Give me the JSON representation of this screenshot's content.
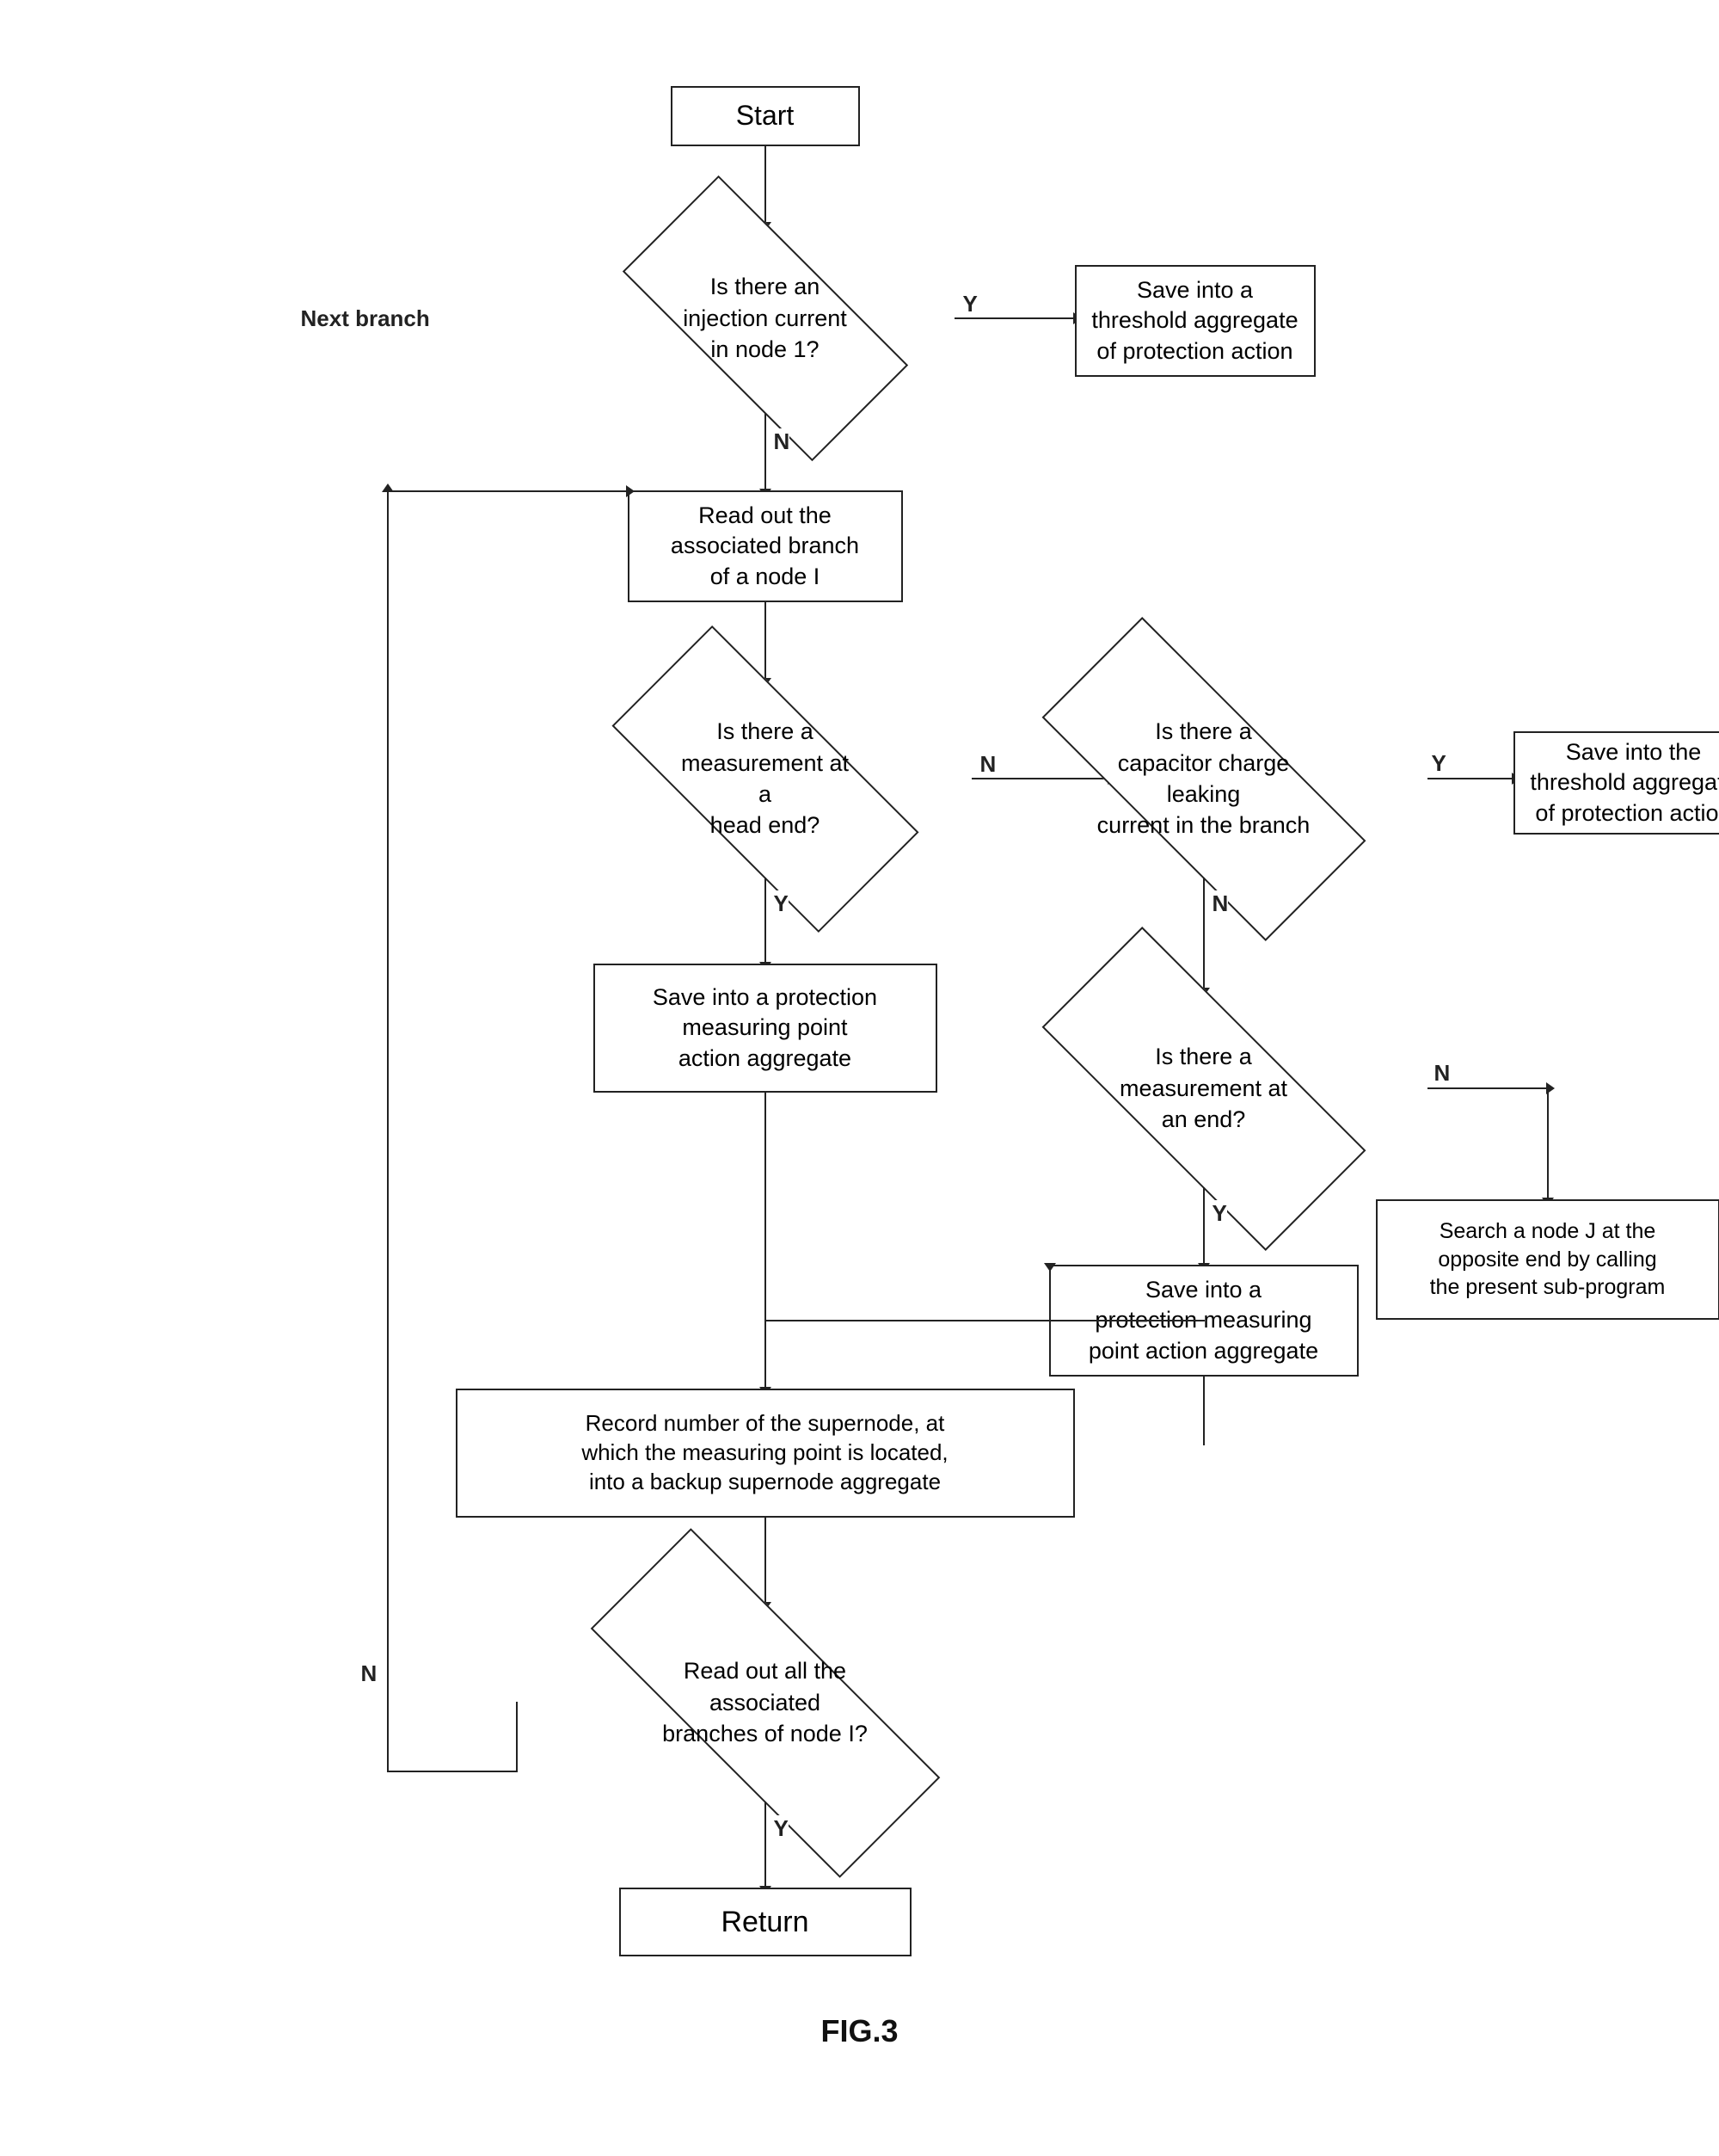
{
  "diagram": {
    "title": "FIG.3",
    "nodes": {
      "start": "Start",
      "injection_q": "Is there an\ninjection current\nin node 1?",
      "save_threshold_1": "Save into a\nthreshold aggregate\nof protection action",
      "read_branch": "Read out the\nassociated branch\nof a node I",
      "measurement_head_q": "Is there a\nmeasurement at a\nhead end?",
      "capacitor_q": "Is there a\ncapacitor charge leaking\ncurrent in the branch",
      "save_threshold_2": "Save into the\nthreshold aggregate\nof protection action",
      "save_protect_1": "Save into a protection\nmeasuring point\naction aggregate",
      "measurement_end_q": "Is there a\nmeasurement at\nan end?",
      "save_protect_2": "Save into a\nprotection measuring\npoint action aggregate",
      "search_node": "Search a node J at the\nopposite end by calling\nthe present sub-program",
      "record_supernode": "Record number of the supernode, at\nwhich the measuring point is located,\ninto a backup supernode aggregate",
      "read_branches_q": "Read out all the associated\nbranches of node I?",
      "return": "Return"
    },
    "labels": {
      "next_branch": "Next branch",
      "y1": "Y",
      "n1": "N",
      "y2": "Y",
      "n2": "N",
      "y3": "Y",
      "n3": "N",
      "y4": "Y",
      "n4": "N",
      "y5": "Y"
    }
  }
}
